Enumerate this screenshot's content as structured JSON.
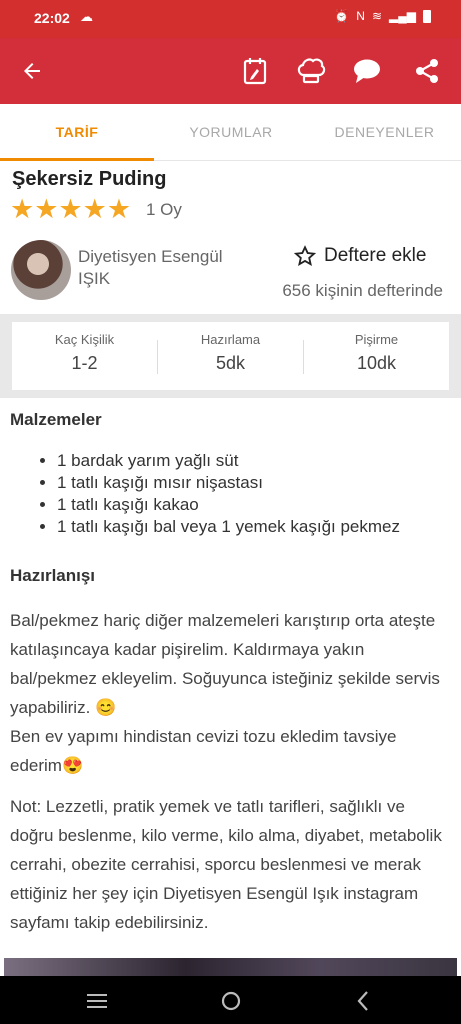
{
  "status": {
    "time": "22:02",
    "cloud": "☁"
  },
  "tabs": [
    "TARİF",
    "YORUMLAR",
    "DENEYENLER"
  ],
  "recipe": {
    "title": "Şekersiz Puding",
    "stars": "★★★★★",
    "rating": 5,
    "votes": "1 Oy",
    "author": "Diyetisyen Esengül IŞIK",
    "fav_label": "Deftere ekle",
    "fav_count": "656 kişinin defterinde"
  },
  "info": {
    "servings_label": "Kaç Kişilik",
    "servings": "1-2",
    "prep_label": "Hazırlama",
    "prep": "5dk",
    "cook_label": "Pişirme",
    "cook": "10dk"
  },
  "ingredients": {
    "heading": "Malzemeler",
    "items": [
      "1 bardak yarım yağlı süt",
      "1 tatlı kaşığı mısır nişastası",
      "1 tatlı kaşığı kakao",
      "1 tatlı kaşığı bal veya 1 yemek kaşığı pekmez"
    ]
  },
  "prep": {
    "heading": "Hazırlanışı",
    "p1": "Bal/pekmez hariç diğer malzemeleri karıştırıp orta ateşte katılaşıncaya kadar pişirelim. Kaldırmaya yakın bal/pekmez ekleyelim. Soğuyunca isteğiniz şekilde servis yapabiliriz. 😊",
    "p2": "Ben ev yapımı hindistan cevizi tozu ekledim tavsiye ederim😍",
    "note": "Not: Lezzetli, pratik yemek ve tatlı tarifleri, sağlıklı ve doğru beslenme, kilo verme, kilo alma, diyabet, metabolik cerrahi, obezite cerrahisi, sporcu beslenmesi ve merak ettiğiniz her şey için Diyetisyen Esengül Işık instagram sayfamı takip edebilirsiniz."
  },
  "colors": {
    "appbar": "#d32f3a",
    "accent": "#f08a00",
    "star": "#f5a623"
  }
}
